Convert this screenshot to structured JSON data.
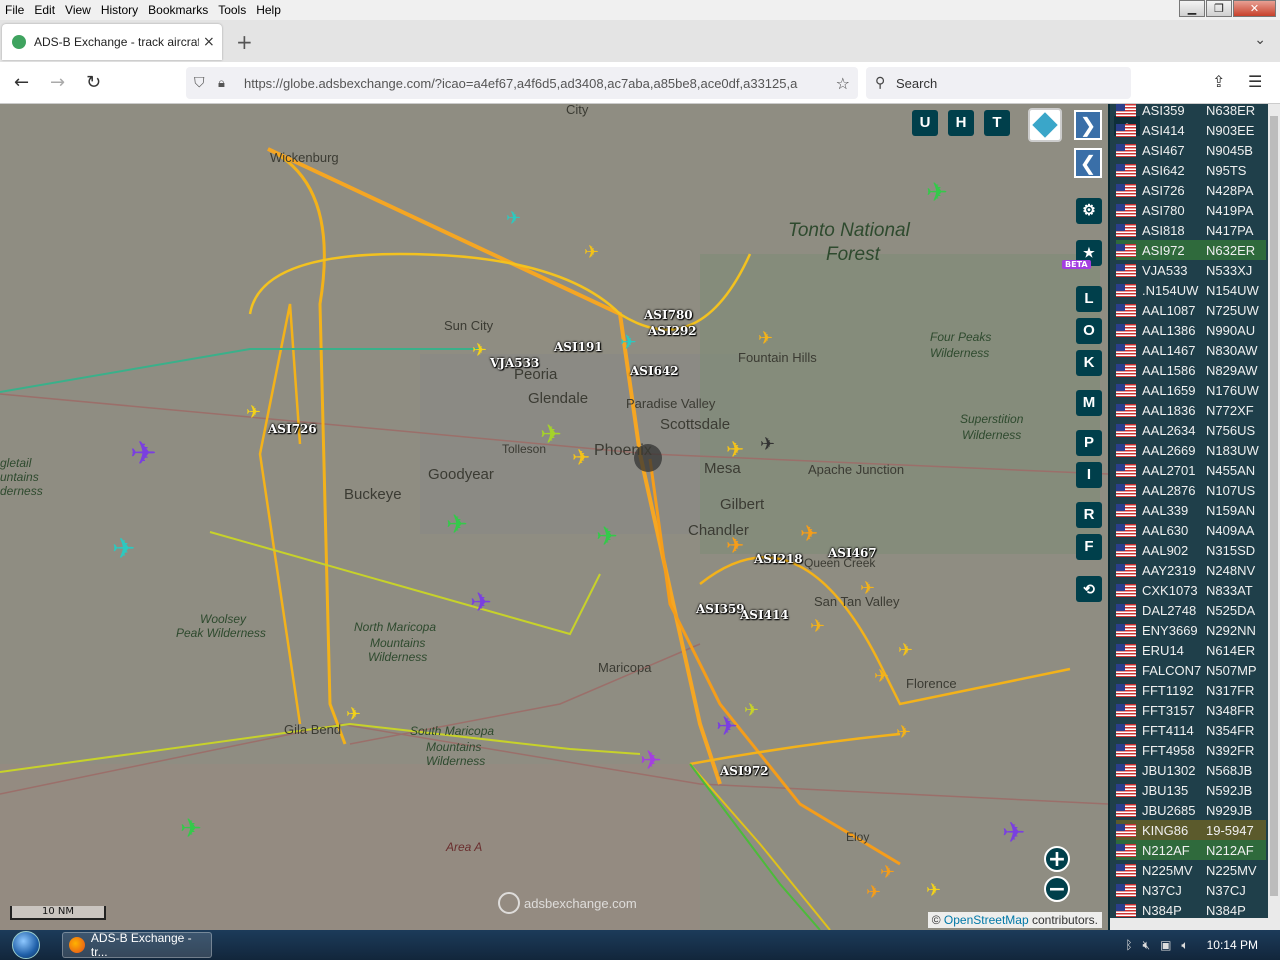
{
  "menubar": {
    "items": [
      "File",
      "Edit",
      "View",
      "History",
      "Bookmarks",
      "Tools",
      "Help"
    ]
  },
  "tab": {
    "title": "ADS-B Exchange - track aircraft",
    "close": "×",
    "new_tab": "+"
  },
  "nav": {
    "url_host": "https://globe.adsbexchange.com",
    "url_path": "/?icao=a4ef67,a4f6d5,ad3408,ac7aba,a85be8,ace0df,a33125,a",
    "search_placeholder": "Search"
  },
  "map": {
    "place_labels": [
      {
        "text": "City",
        "name": "city"
      },
      {
        "text": "Wickenburg",
        "name": "wickenburg"
      },
      {
        "text": "Tonto National",
        "name": "tonto-1"
      },
      {
        "text": "Forest",
        "name": "tonto-2"
      },
      {
        "text": "Sun City",
        "name": "sun-city"
      },
      {
        "text": "Peoria",
        "name": "peoria"
      },
      {
        "text": "Glendale",
        "name": "glendale"
      },
      {
        "text": "Paradise Valley",
        "name": "paradise-valley"
      },
      {
        "text": "Scottsdale",
        "name": "scottsdale"
      },
      {
        "text": "Fountain Hills",
        "name": "fountain-hills"
      },
      {
        "text": "Four Peaks",
        "name": "four-peaks-1"
      },
      {
        "text": "Wilderness",
        "name": "four-peaks-2"
      },
      {
        "text": "Tolleson",
        "name": "tolleson"
      },
      {
        "text": "Phoenix",
        "name": "phoenix"
      },
      {
        "text": "Mesa",
        "name": "mesa"
      },
      {
        "text": "Apache Junction",
        "name": "apache-junction"
      },
      {
        "text": "Superstition",
        "name": "superstition-1"
      },
      {
        "text": "Wilderness",
        "name": "superstition-2"
      },
      {
        "text": "Goodyear",
        "name": "goodyear"
      },
      {
        "text": "Buckeye",
        "name": "buckeye"
      },
      {
        "text": "Gilbert",
        "name": "gilbert"
      },
      {
        "text": "Chandler",
        "name": "chandler"
      },
      {
        "text": "Queen Creek",
        "name": "queen-creek"
      },
      {
        "text": "San Tan Valley",
        "name": "san-tan-valley"
      },
      {
        "text": "Woolsey",
        "name": "woolsey-1"
      },
      {
        "text": "Peak Wilderness",
        "name": "woolsey-2"
      },
      {
        "text": "North Maricopa",
        "name": "n-maricopa-1"
      },
      {
        "text": "Mountains",
        "name": "n-maricopa-2"
      },
      {
        "text": "Wilderness",
        "name": "n-maricopa-3"
      },
      {
        "text": "Maricopa",
        "name": "maricopa"
      },
      {
        "text": "Florence",
        "name": "florence"
      },
      {
        "text": "Gila Bend",
        "name": "gila-bend"
      },
      {
        "text": "South Maricopa",
        "name": "s-maricopa-1"
      },
      {
        "text": "Mountains",
        "name": "s-maricopa-2"
      },
      {
        "text": "Wilderness",
        "name": "s-maricopa-3"
      },
      {
        "text": "Area A",
        "name": "area-a"
      },
      {
        "text": "Eloy",
        "name": "eloy"
      },
      {
        "text": "gletail",
        "name": "eagletail-1"
      },
      {
        "text": "untains",
        "name": "eagletail-2"
      },
      {
        "text": "derness",
        "name": "eagletail-3"
      }
    ],
    "aircraft_labels": [
      "ASI780",
      "ASI292",
      "ASI191",
      "VJA533",
      "ASI642",
      "ASI726",
      "ASI218",
      "ASI467",
      "ASI359",
      "ASI414",
      "ASI972"
    ],
    "top_buttons": [
      "U",
      "H",
      "T"
    ],
    "side_buttons": [
      "L",
      "O",
      "K",
      "M",
      "P",
      "I",
      "R",
      "F"
    ],
    "beta_label": "BETA",
    "scale_label": "10 NM",
    "watermark": "adsbexchange.com",
    "attribution_prefix": "©",
    "attribution_link": "OpenStreetMap",
    "attribution_suffix": "contributors.",
    "zoom_in": "+",
    "zoom_out": "−"
  },
  "table": {
    "rows": [
      {
        "callsign": "ASI359",
        "reg": "N638ER",
        "style": ""
      },
      {
        "callsign": "ASI414",
        "reg": "N903EE",
        "style": ""
      },
      {
        "callsign": "ASI467",
        "reg": "N9045B",
        "style": ""
      },
      {
        "callsign": "ASI642",
        "reg": "N95TS",
        "style": ""
      },
      {
        "callsign": "ASI726",
        "reg": "N428PA",
        "style": ""
      },
      {
        "callsign": "ASI780",
        "reg": "N419PA",
        "style": ""
      },
      {
        "callsign": "ASI818",
        "reg": "N417PA",
        "style": ""
      },
      {
        "callsign": "ASI972",
        "reg": "N632ER",
        "style": "green"
      },
      {
        "callsign": "VJA533",
        "reg": "N533XJ",
        "style": ""
      },
      {
        "callsign": ".N154UW",
        "reg": "N154UW",
        "style": ""
      },
      {
        "callsign": "AAL1087",
        "reg": "N725UW",
        "style": ""
      },
      {
        "callsign": "AAL1386",
        "reg": "N990AU",
        "style": ""
      },
      {
        "callsign": "AAL1467",
        "reg": "N830AW",
        "style": ""
      },
      {
        "callsign": "AAL1586",
        "reg": "N829AW",
        "style": ""
      },
      {
        "callsign": "AAL1659",
        "reg": "N176UW",
        "style": ""
      },
      {
        "callsign": "AAL1836",
        "reg": "N772XF",
        "style": ""
      },
      {
        "callsign": "AAL2634",
        "reg": "N756US",
        "style": ""
      },
      {
        "callsign": "AAL2669",
        "reg": "N183UW",
        "style": ""
      },
      {
        "callsign": "AAL2701",
        "reg": "N455AN",
        "style": ""
      },
      {
        "callsign": "AAL2876",
        "reg": "N107US",
        "style": ""
      },
      {
        "callsign": "AAL339",
        "reg": "N159AN",
        "style": ""
      },
      {
        "callsign": "AAL630",
        "reg": "N409AA",
        "style": ""
      },
      {
        "callsign": "AAL902",
        "reg": "N315SD",
        "style": ""
      },
      {
        "callsign": "AAY2319",
        "reg": "N248NV",
        "style": ""
      },
      {
        "callsign": "CXK1073",
        "reg": "N833AT",
        "style": ""
      },
      {
        "callsign": "DAL2748",
        "reg": "N525DA",
        "style": ""
      },
      {
        "callsign": "ENY3669",
        "reg": "N292NN",
        "style": ""
      },
      {
        "callsign": "ERU14",
        "reg": "N614ER",
        "style": ""
      },
      {
        "callsign": "FALCON7",
        "reg": "N507MP",
        "style": ""
      },
      {
        "callsign": "FFT1192",
        "reg": "N317FR",
        "style": ""
      },
      {
        "callsign": "FFT3157",
        "reg": "N348FR",
        "style": ""
      },
      {
        "callsign": "FFT4114",
        "reg": "N354FR",
        "style": ""
      },
      {
        "callsign": "FFT4958",
        "reg": "N392FR",
        "style": ""
      },
      {
        "callsign": "JBU1302",
        "reg": "N568JB",
        "style": ""
      },
      {
        "callsign": "JBU135",
        "reg": "N592JB",
        "style": ""
      },
      {
        "callsign": "JBU2685",
        "reg": "N929JB",
        "style": ""
      },
      {
        "callsign": "KING86",
        "reg": "19-5947",
        "style": "olive"
      },
      {
        "callsign": "N212AF",
        "reg": "N212AF",
        "style": "green"
      },
      {
        "callsign": "N225MV",
        "reg": "N225MV",
        "style": ""
      },
      {
        "callsign": "N37CJ",
        "reg": "N37CJ",
        "style": ""
      },
      {
        "callsign": "N384P",
        "reg": "N384P",
        "style": ""
      }
    ]
  },
  "taskbar": {
    "task_label": "ADS-B Exchange - tr...",
    "clock": "10:14 PM"
  }
}
